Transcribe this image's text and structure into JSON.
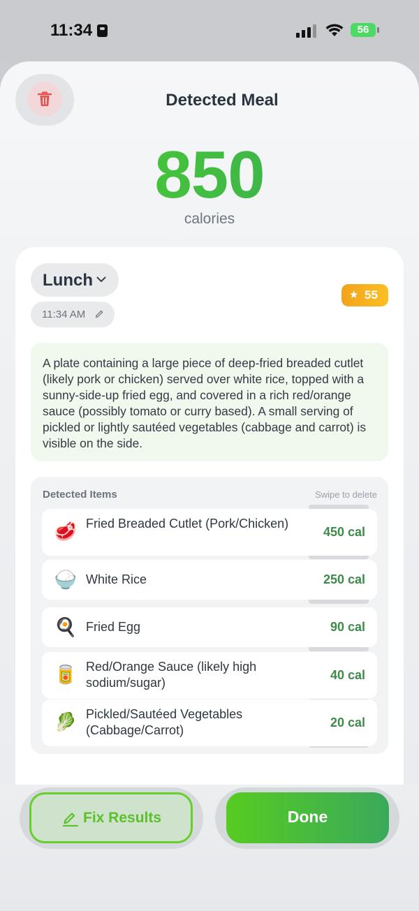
{
  "status_bar": {
    "time": "11:34",
    "battery": "56"
  },
  "header": {
    "title": "Detected Meal",
    "delete_icon": "trash-icon"
  },
  "calories": {
    "value": "850",
    "unit": "calories"
  },
  "meal": {
    "type": "Lunch",
    "time": "11:34 AM",
    "score": "55",
    "score_icon": "star-icon"
  },
  "description": "A plate containing a large piece of deep-fried breaded cutlet (likely pork or chicken) served over white rice, topped with a sunny-side-up fried egg, and covered in a rich red/orange sauce (possibly tomato or curry based). A small serving of pickled or lightly sautéed vegetables (cabbage and carrot) is visible on the side.",
  "detected_items": {
    "header": "Detected Items",
    "hint": "Swipe to delete",
    "items": [
      {
        "emoji": "🥩",
        "name": "Fried Breaded Cutlet (Pork/Chicken)",
        "calories": "450 cal"
      },
      {
        "emoji": "🍚",
        "name": "White Rice",
        "calories": "250 cal"
      },
      {
        "emoji": "🍳",
        "name": "Fried Egg",
        "calories": "90 cal"
      },
      {
        "emoji": "🥫",
        "name": "Red/Orange Sauce (likely high sodium/sugar)",
        "calories": "40 cal"
      },
      {
        "emoji": "🥬",
        "name": "Pickled/Sautéed Vegetables (Cabbage/Carrot)",
        "calories": "20 cal"
      }
    ]
  },
  "actions": {
    "fix_label": "Fix Results",
    "done_label": "Done"
  },
  "colors": {
    "accent_green": "#4fd32a",
    "delete_red": "#e45454",
    "score_orange": "#f2a31b"
  }
}
